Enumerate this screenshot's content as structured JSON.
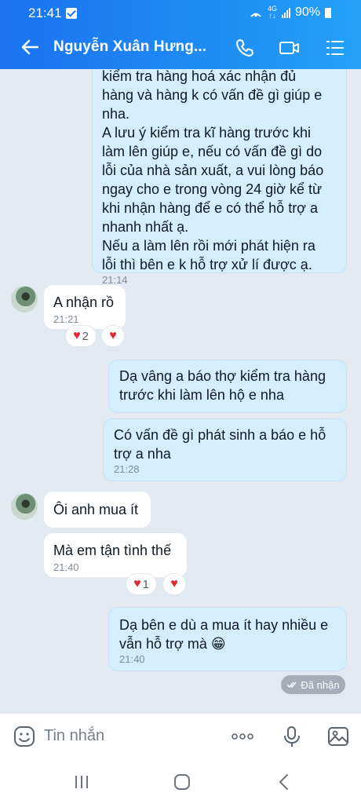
{
  "status_bar": {
    "time": "21:41",
    "network": "4G",
    "battery": "90%"
  },
  "header": {
    "title": "Nguyễn Xuân Hưng..."
  },
  "messages": [
    {
      "dir": "out",
      "lines": [
        "kiểm tra hàng hoá xác nhận đủ",
        "hàng và hàng k có vấn đề gì giúp e",
        "nha.",
        "A lưu ý kiểm tra kĩ hàng trước khi",
        "làm lên giúp e, nếu có vấn đề gì do",
        "lỗi của nhà sản xuất, a vui lòng báo",
        "ngay cho e trong vòng 24 giờ kể từ",
        "khi nhận hàng để e có thể hỗ trợ a",
        "nhanh nhất ạ.",
        "Nếu a làm lên rồi mới phát hiện ra",
        "lỗi thì bên e k hỗ trợ xử lí được ạ."
      ],
      "time": "21:14"
    },
    {
      "dir": "in",
      "text": "A nhận rồ",
      "time": "21:21",
      "reaction_count": "2"
    },
    {
      "dir": "out",
      "lines": [
        "Dạ vâng a báo thợ kiểm tra hàng",
        "trước khi làm lên hộ e nha"
      ]
    },
    {
      "dir": "out",
      "lines": [
        "Có vấn đề gì phát sinh a báo e hỗ",
        "trợ a nha"
      ],
      "time": "21:28"
    },
    {
      "dir": "in",
      "text": "Ôi anh mua ít"
    },
    {
      "dir": "in",
      "text": "Mà em tận tình thế",
      "time": "21:40",
      "reaction_count": "1"
    },
    {
      "dir": "out",
      "lines": [
        "Dạ bên e dù a mua ít hay nhiều e",
        "vẫn hỗ trợ mà 😁"
      ],
      "time": "21:40"
    }
  ],
  "received_label": "Đã nhận",
  "composer": {
    "placeholder": "Tin nhắn"
  },
  "colors": {
    "header": "#1f8df5",
    "outgoing_bubble": "#d4eefd",
    "incoming_bubble": "#ffffff",
    "background": "#e2e9f1",
    "heart": "#e32636"
  }
}
